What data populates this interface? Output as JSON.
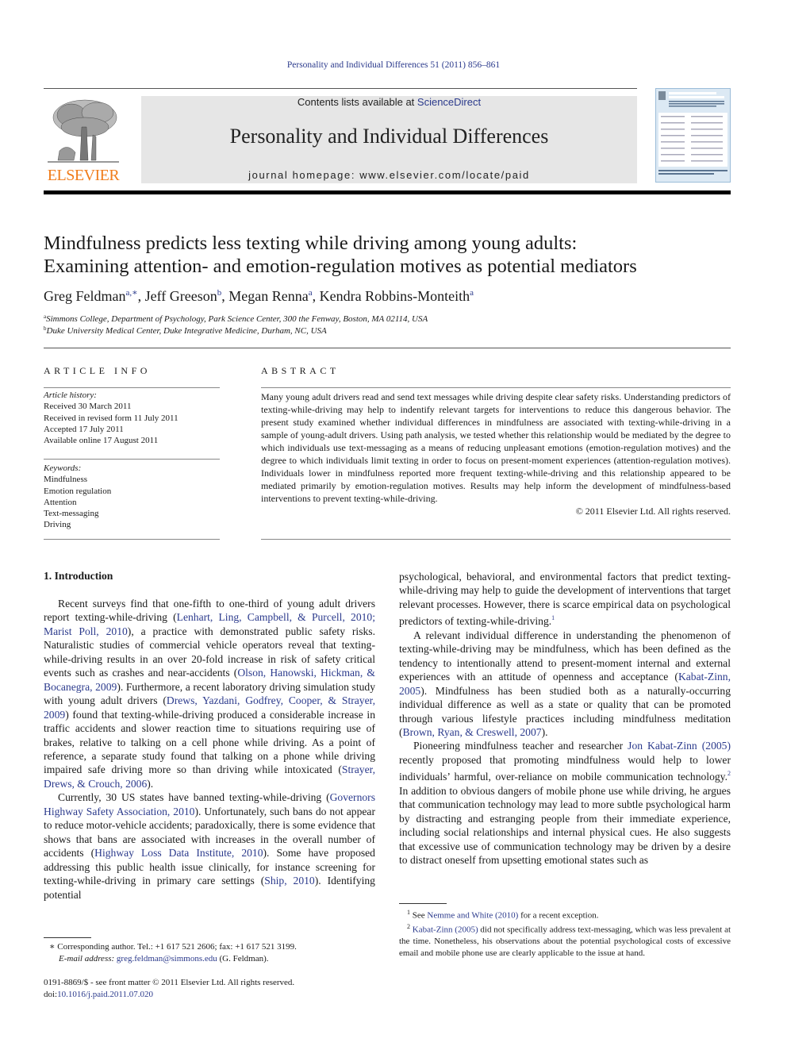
{
  "running_head": "Personality and Individual Differences 51 (2011) 856–861",
  "journal_banner": {
    "contents_prefix": "Contents lists available at ",
    "contents_link": "ScienceDirect",
    "journal_title": "Personality and Individual Differences",
    "homepage": "journal homepage: www.elsevier.com/locate/paid",
    "publisher_logo_text": "ELSEVIER",
    "publisher_logo_icon": "tree-logo-icon",
    "cover_icon": "journal-cover-thumbnail",
    "colors": {
      "banner_bg": "#e6e6e6",
      "logo_orange": "#f07c1a",
      "link": "#2b3a8c",
      "cover_bg": "#dce9f4"
    }
  },
  "article": {
    "title_line1": "Mindfulness predicts less texting while driving among young adults:",
    "title_line2": "Examining attention- and emotion-regulation motives as potential mediators",
    "authors": [
      {
        "name": "Greg Feldman",
        "sup": "a,∗"
      },
      {
        "name": "Jeff Greeson",
        "sup": "b"
      },
      {
        "name": "Megan Renna",
        "sup": "a"
      },
      {
        "name": "Kendra Robbins-Monteith",
        "sup": "a"
      }
    ],
    "affiliations": [
      {
        "mark": "a",
        "text": "Simmons College, Department of Psychology, Park Science Center, 300 the Fenway, Boston, MA 02114, USA"
      },
      {
        "mark": "b",
        "text": "Duke University Medical Center, Duke Integrative Medicine, Durham, NC, USA"
      }
    ]
  },
  "article_info": {
    "label": "ARTICLE INFO",
    "history_label": "Article history:",
    "history": [
      "Received 30 March 2011",
      "Received in revised form 11 July 2011",
      "Accepted 17 July 2011",
      "Available online 17 August 2011"
    ],
    "keywords_label": "Keywords:",
    "keywords": [
      "Mindfulness",
      "Emotion regulation",
      "Attention",
      "Text-messaging",
      "Driving"
    ]
  },
  "abstract": {
    "label": "ABSTRACT",
    "text": "Many young adult drivers read and send text messages while driving despite clear safety risks. Understanding predictors of texting-while-driving may help to indentify relevant targets for interventions to reduce this dangerous behavior. The present study examined whether individual differences in mindfulness are associated with texting-while-driving in a sample of young-adult drivers. Using path analysis, we tested whether this relationship would be mediated by the degree to which individuals use text-messaging as a means of reducing unpleasant emotions (emotion-regulation motives) and the degree to which individuals limit texting in order to focus on present-moment experiences (attention-regulation motives). Individuals lower in mindfulness reported more frequent texting-while-driving and this relationship appeared to be mediated primarily by emotion-regulation motives. Results may help inform the development of mindfulness-based interventions to prevent texting-while-driving.",
    "copyright": "© 2011 Elsevier Ltd. All rights reserved."
  },
  "body": {
    "section_heading": "1. Introduction",
    "p1": [
      {
        "t": "Recent surveys find that one-fifth to one-third of young adult drivers report texting-while-driving ("
      },
      {
        "link": "Lenhart, Ling, Campbell, & Purcell, 2010; Marist Poll, 2010"
      },
      {
        "t": "), a practice with demonstrated public safety risks. Naturalistic studies of commercial vehicle operators reveal that texting-while-driving results in an over 20-fold increase in risk of safety critical events such as crashes and near-accidents ("
      },
      {
        "link": "Olson, Hanowski, Hickman, & Bocanegra, 2009"
      },
      {
        "t": "). Furthermore, a recent laboratory driving simulation study with young adult drivers ("
      },
      {
        "link": "Drews, Yazdani, Godfrey, Cooper, & Strayer, 2009"
      },
      {
        "t": ") found that texting-while-driving produced a considerable increase in traffic accidents and slower reaction time to situations requiring use of brakes, relative to talking on a cell phone while driving. As a point of reference, a separate study found that talking on a phone while driving impaired safe driving more so than driving while intoxicated ("
      },
      {
        "link": "Strayer, Drews, & Crouch, 2006"
      },
      {
        "t": ")."
      }
    ],
    "p2": [
      {
        "t": "Currently, 30 US states have banned texting-while-driving ("
      },
      {
        "link": "Governors Highway Safety Association, 2010"
      },
      {
        "t": "). Unfortunately, such bans do not appear to reduce motor-vehicle accidents; paradoxically, there is some evidence that shows that bans are associated with increases in the overall number of accidents ("
      },
      {
        "link": "Highway Loss Data Institute, 2010"
      },
      {
        "t": "). Some have proposed addressing this public health issue clinically, for instance screening for texting-while-driving in primary care settings ("
      },
      {
        "link": "Ship, 2010"
      },
      {
        "t": "). Identifying potential psychological, behavioral, and environmental factors that predict texting-while-driving may help to guide the development of interventions that target relevant processes. However, there is scarce empirical data on psychological predictors of texting-while-driving."
      },
      {
        "fn": "1"
      }
    ],
    "p3": [
      {
        "t": "A relevant individual difference in understanding the phenomenon of texting-while-driving may be mindfulness, which has been defined as the tendency to intentionally attend to present-moment internal and external experiences with an attitude of openness and acceptance ("
      },
      {
        "link": "Kabat-Zinn, 2005"
      },
      {
        "t": "). Mindfulness has been studied both as a naturally-occurring individual difference as well as a state or quality that can be promoted through various lifestyle practices including mindfulness meditation ("
      },
      {
        "link": "Brown, Ryan, & Creswell, 2007"
      },
      {
        "t": ")."
      }
    ],
    "p4": [
      {
        "t": "Pioneering mindfulness teacher and researcher "
      },
      {
        "link": "Jon Kabat-Zinn (2005)"
      },
      {
        "t": " recently proposed that promoting mindfulness would help to lower individuals’ harmful, over-reliance on mobile communication technology."
      },
      {
        "fn": "2"
      },
      {
        "t": " In addition to obvious dangers of mobile phone use while driving, he argues that communication technology may lead to more subtle psychological harm by distracting and estranging people from their immediate experience, including social relationships and internal physical cues. He also suggests that excessive use of communication technology may be driven by a desire to distract oneself from upsetting emotional states such as"
      }
    ]
  },
  "footnotes_left": {
    "corresponding": "∗ Corresponding author. Tel.: +1 617 521 2606; fax: +1 617 521 3199.",
    "email_label": "E-mail address: ",
    "email": "greg.feldman@simmons.edu",
    "email_suffix": " (G. Feldman).",
    "issn": "0191-8869/$ - see front matter © 2011 Elsevier Ltd. All rights reserved.",
    "doi_prefix": "doi:",
    "doi": "10.1016/j.paid.2011.07.020"
  },
  "footnotes_right": [
    {
      "mark": "1",
      "parts": [
        {
          "t": "See "
        },
        {
          "link": "Nemme and White (2010)"
        },
        {
          "t": " for a recent exception."
        }
      ]
    },
    {
      "mark": "2",
      "parts": [
        {
          "link": "Kabat-Zinn (2005)"
        },
        {
          "t": " did not specifically address text-messaging, which was less prevalent at the time. Nonetheless, his observations about the potential psychological costs of excessive email and mobile phone use are clearly applicable to the issue at hand."
        }
      ]
    }
  ]
}
